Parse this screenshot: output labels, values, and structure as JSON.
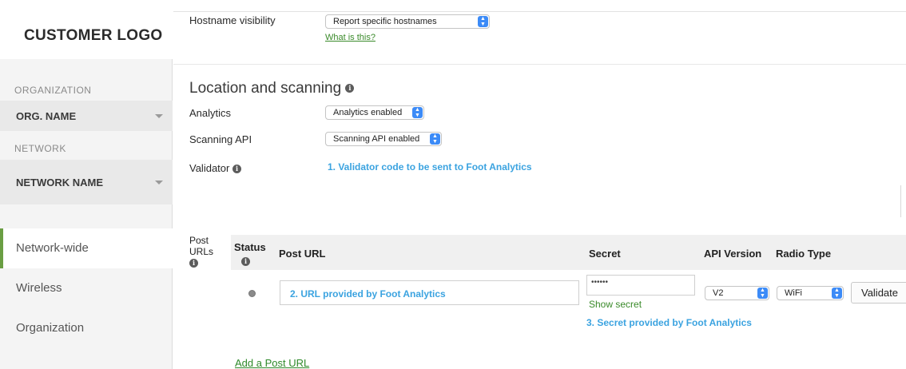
{
  "sidebar": {
    "logo": "CUSTOMER LOGO",
    "organization_label": "ORGANIZATION",
    "organization_value": "ORG. NAME",
    "network_label": "NETWORK",
    "network_value": "NETWORK NAME",
    "nav": [
      {
        "label": "Network-wide",
        "active": true
      },
      {
        "label": "Wireless",
        "active": false
      },
      {
        "label": "Organization",
        "active": false
      }
    ]
  },
  "hostname": {
    "label": "Hostname visibility",
    "select_value": "Report specific hostnames",
    "help_link": "What is this?"
  },
  "location": {
    "title": "Location and scanning",
    "analytics_label": "Analytics",
    "analytics_value": "Analytics enabled",
    "scanning_label": "Scanning API",
    "scanning_value": "Scanning API enabled",
    "validator_label": "Validator",
    "validator_note": "1. Validator code to be sent to Foot Analytics"
  },
  "post_urls": {
    "label_line1": "Post",
    "label_line2": "URLs",
    "columns": {
      "status_line1": "Status",
      "post_url": "Post URL",
      "secret": "Secret",
      "api_version": "API Version",
      "radio_type": "Radio Type"
    },
    "row": {
      "url_value": "2. URL provided by Foot Analytics",
      "secret_value": "••••••",
      "show_secret": "Show secret",
      "secret_note": "3. Secret provided by Foot Analytics",
      "api_version": "V2",
      "radio_type": "WiFi",
      "validate": "Validate"
    },
    "add_link": "Add a Post URL"
  },
  "colors": {
    "accent_green": "#6a9e43",
    "link_green": "#3a8a2a",
    "note_blue": "#3ba3e0",
    "select_blue": "#3c8bf7"
  }
}
